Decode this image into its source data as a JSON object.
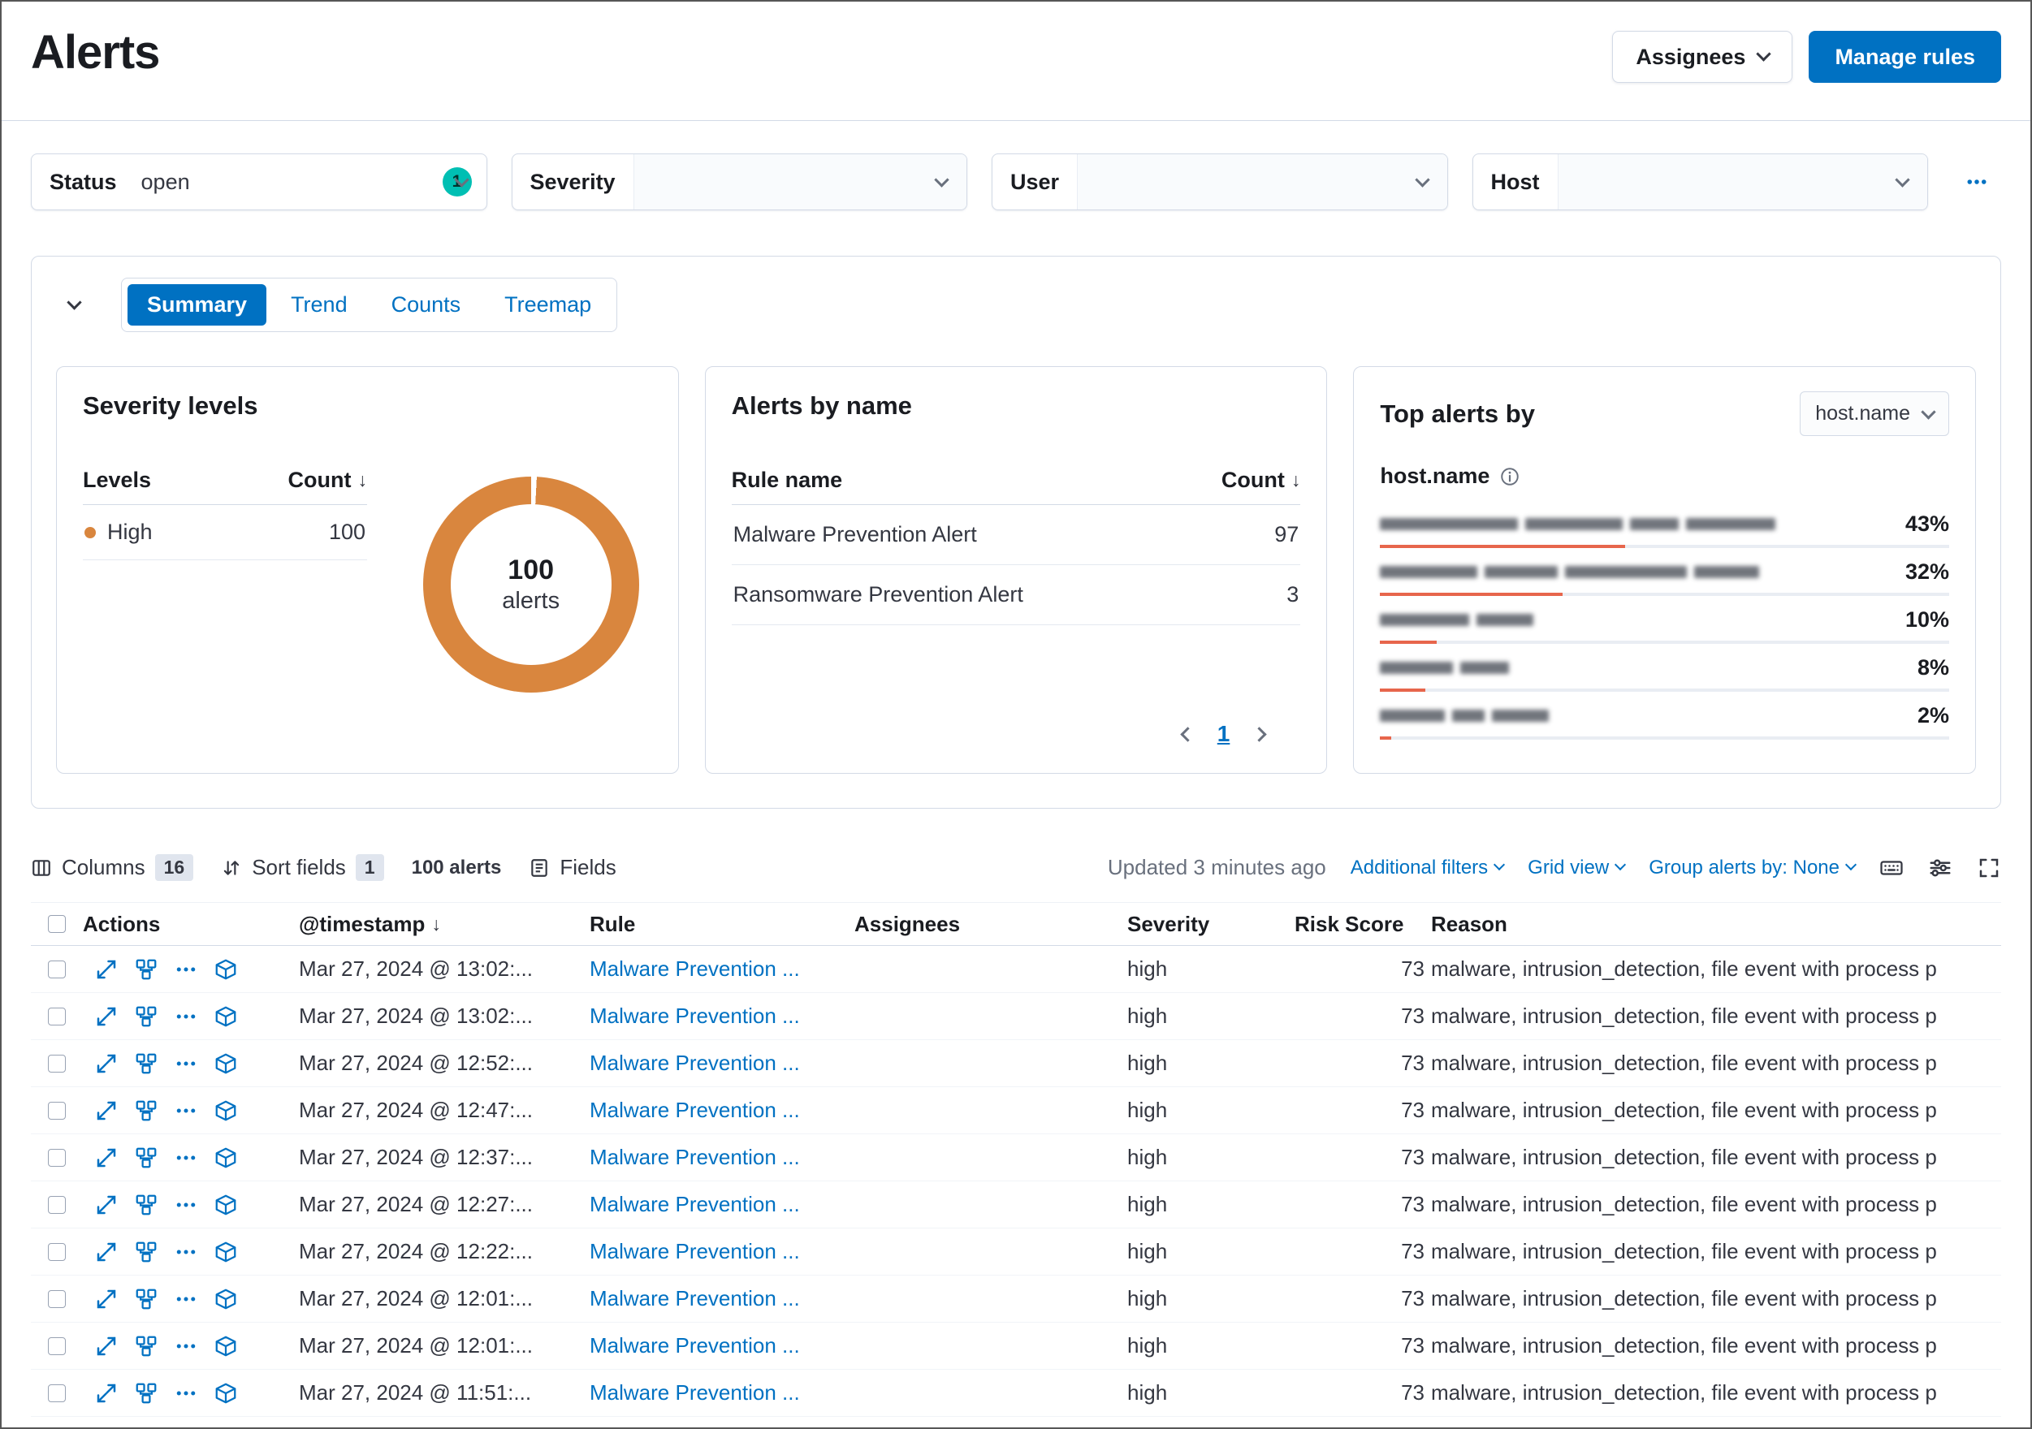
{
  "page": {
    "title": "Alerts"
  },
  "header": {
    "assignees_button": "Assignees",
    "manage_rules_button": "Manage rules"
  },
  "filters": [
    {
      "label": "Status",
      "value": "open",
      "badge": "1"
    },
    {
      "label": "Severity",
      "value": ""
    },
    {
      "label": "User",
      "value": ""
    },
    {
      "label": "Host",
      "value": ""
    }
  ],
  "charts": {
    "tabs": [
      "Summary",
      "Trend",
      "Counts",
      "Treemap"
    ],
    "active_tab": "Summary",
    "severity_card": {
      "title": "Severity levels",
      "col_levels": "Levels",
      "col_count": "Count",
      "rows": [
        {
          "level": "High",
          "count": "100"
        }
      ],
      "donut_value": "100",
      "donut_label": "alerts"
    },
    "alerts_by_name_card": {
      "title": "Alerts by name",
      "col_rule": "Rule name",
      "col_count": "Count",
      "rows": [
        {
          "rule": "Malware Prevention Alert",
          "count": "97"
        },
        {
          "rule": "Ransomware Prevention Alert",
          "count": "3"
        }
      ],
      "page": "1"
    },
    "top_alerts_card": {
      "title": "Top alerts by",
      "select_value": "host.name",
      "field_label": "host.name",
      "rows": [
        {
          "pct": "43%",
          "pct_num": 43
        },
        {
          "pct": "32%",
          "pct_num": 32
        },
        {
          "pct": "10%",
          "pct_num": 10
        },
        {
          "pct": "8%",
          "pct_num": 8
        },
        {
          "pct": "2%",
          "pct_num": 2
        }
      ]
    }
  },
  "toolbar": {
    "columns_label": "Columns",
    "columns_count": "16",
    "sort_label": "Sort fields",
    "sort_count": "1",
    "alert_count": "100 alerts",
    "fields_label": "Fields",
    "updated": "Updated 3 minutes ago",
    "additional_filters": "Additional filters",
    "grid_view": "Grid view",
    "group_by": "Group alerts by: None"
  },
  "table": {
    "headers": [
      "Actions",
      "@timestamp",
      "Rule",
      "Assignees",
      "Severity",
      "Risk Score",
      "Reason"
    ],
    "rows": [
      {
        "timestamp": "Mar 27, 2024 @ 13:02:...",
        "rule": "Malware Prevention ...",
        "assignees": "",
        "severity": "high",
        "risk": "73",
        "reason": "malware, intrusion_detection, file event with process p"
      },
      {
        "timestamp": "Mar 27, 2024 @ 13:02:...",
        "rule": "Malware Prevention ...",
        "assignees": "",
        "severity": "high",
        "risk": "73",
        "reason": "malware, intrusion_detection, file event with process p"
      },
      {
        "timestamp": "Mar 27, 2024 @ 12:52:...",
        "rule": "Malware Prevention ...",
        "assignees": "",
        "severity": "high",
        "risk": "73",
        "reason": "malware, intrusion_detection, file event with process p"
      },
      {
        "timestamp": "Mar 27, 2024 @ 12:47:...",
        "rule": "Malware Prevention ...",
        "assignees": "",
        "severity": "high",
        "risk": "73",
        "reason": "malware, intrusion_detection, file event with process p"
      },
      {
        "timestamp": "Mar 27, 2024 @ 12:37:...",
        "rule": "Malware Prevention ...",
        "assignees": "",
        "severity": "high",
        "risk": "73",
        "reason": "malware, intrusion_detection, file event with process p"
      },
      {
        "timestamp": "Mar 27, 2024 @ 12:27:...",
        "rule": "Malware Prevention ...",
        "assignees": "",
        "severity": "high",
        "risk": "73",
        "reason": "malware, intrusion_detection, file event with process p"
      },
      {
        "timestamp": "Mar 27, 2024 @ 12:22:...",
        "rule": "Malware Prevention ...",
        "assignees": "",
        "severity": "high",
        "risk": "73",
        "reason": "malware, intrusion_detection, file event with process p"
      },
      {
        "timestamp": "Mar 27, 2024 @ 12:01:...",
        "rule": "Malware Prevention ...",
        "assignees": "",
        "severity": "high",
        "risk": "73",
        "reason": "malware, intrusion_detection, file event with process p"
      },
      {
        "timestamp": "Mar 27, 2024 @ 12:01:...",
        "rule": "Malware Prevention ...",
        "assignees": "",
        "severity": "high",
        "risk": "73",
        "reason": "malware, intrusion_detection, file event with process p"
      },
      {
        "timestamp": "Mar 27, 2024 @ 11:51:...",
        "rule": "Malware Prevention ...",
        "assignees": "",
        "severity": "high",
        "risk": "73",
        "reason": "malware, intrusion_detection, file event with process p"
      }
    ]
  },
  "colors": {
    "accent_blue": "#0071c2",
    "donut_orange": "#d9863e",
    "bar_red": "#e7664c",
    "badge_teal": "#00bfb3"
  }
}
